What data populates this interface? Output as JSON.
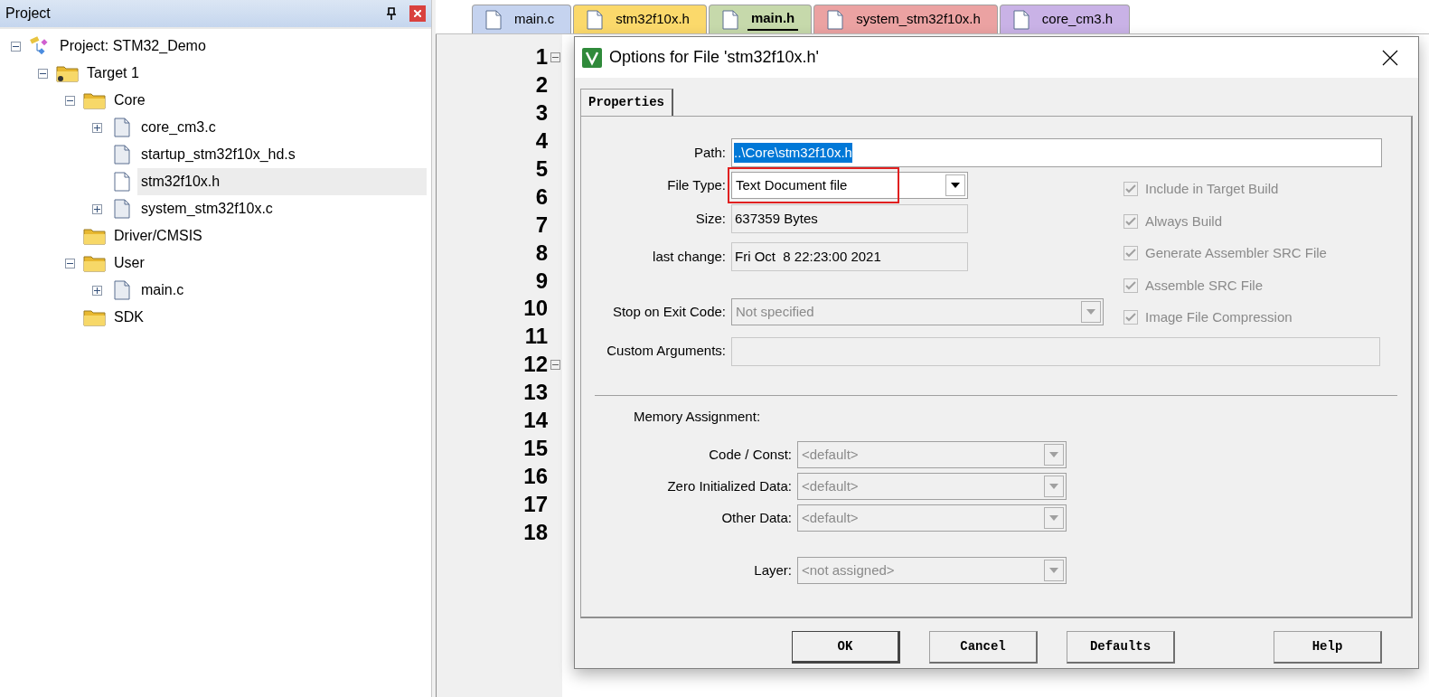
{
  "project_panel": {
    "title": "Project",
    "tree": [
      {
        "label": "Project: STM32_Demo",
        "kind": "project",
        "expanded": true,
        "selected": false,
        "children": [
          {
            "label": "Target 1",
            "kind": "target",
            "expanded": true,
            "selected": false,
            "children": [
              {
                "label": "Core",
                "kind": "folder",
                "expanded": true,
                "selected": false,
                "children": [
                  {
                    "label": "core_cm3.c",
                    "kind": "file",
                    "expanded": false,
                    "selected": false
                  },
                  {
                    "label": "startup_stm32f10x_hd.s",
                    "kind": "file",
                    "selected": false
                  },
                  {
                    "label": "stm32f10x.h",
                    "kind": "header",
                    "selected": true
                  },
                  {
                    "label": "system_stm32f10x.c",
                    "kind": "file",
                    "expanded": false,
                    "selected": false
                  }
                ]
              },
              {
                "label": "Driver/CMSIS",
                "kind": "folder",
                "selected": false
              },
              {
                "label": "User",
                "kind": "folder",
                "expanded": true,
                "selected": false,
                "children": [
                  {
                    "label": "main.c",
                    "kind": "file",
                    "expanded": false,
                    "selected": false
                  }
                ]
              },
              {
                "label": "SDK",
                "kind": "folder",
                "selected": false
              }
            ]
          }
        ]
      }
    ]
  },
  "editor": {
    "tabs": [
      {
        "label": "main.c",
        "color": "#c5d3ef",
        "selected": false
      },
      {
        "label": "stm32f10x.h",
        "color": "#fbd96b",
        "selected": false
      },
      {
        "label": "main.h",
        "color": "#c6d9ab",
        "selected": true
      },
      {
        "label": "system_stm32f10x.h",
        "color": "#eba2a2",
        "selected": false
      },
      {
        "label": "core_cm3.h",
        "color": "#c9b2e6",
        "selected": false
      }
    ],
    "lines": [
      {
        "number": "1",
        "foldable": true
      },
      {
        "number": "2",
        "foldable": false
      },
      {
        "number": "3",
        "foldable": false
      },
      {
        "number": "4",
        "foldable": false
      },
      {
        "number": "5",
        "foldable": false
      },
      {
        "number": "6",
        "foldable": false
      },
      {
        "number": "7",
        "foldable": false
      },
      {
        "number": "8",
        "foldable": false
      },
      {
        "number": "9",
        "foldable": false
      },
      {
        "number": "10",
        "foldable": false
      },
      {
        "number": "11",
        "foldable": false
      },
      {
        "number": "12",
        "foldable": true
      },
      {
        "number": "13",
        "foldable": false
      },
      {
        "number": "14",
        "foldable": false
      },
      {
        "number": "15",
        "foldable": false
      },
      {
        "number": "16",
        "foldable": false
      },
      {
        "number": "17",
        "foldable": false
      },
      {
        "number": "18",
        "foldable": false
      }
    ]
  },
  "dialog": {
    "title": "Options for File 'stm32f10x.h'",
    "tabs": [
      {
        "label": "Properties",
        "selected": true
      }
    ],
    "path": {
      "label": "Path:",
      "value": "..\\Core\\stm32f10x.h"
    },
    "file_type": {
      "label": "File Type:",
      "value": "Text Document file",
      "highlighted": true
    },
    "size": {
      "label": "Size:",
      "value": "637359 Bytes"
    },
    "last_change": {
      "label": "last change:",
      "value": "Fri Oct  8 22:23:00 2021"
    },
    "stop_on_exit": {
      "label": "Stop on Exit Code:",
      "value": "Not specified",
      "disabled": true
    },
    "custom_arguments": {
      "label": "Custom Arguments:"
    },
    "options": [
      {
        "label": "Include in Target Build",
        "checked": true,
        "disabled": true
      },
      {
        "label": "Always Build",
        "checked": true,
        "disabled": true
      },
      {
        "label": "Generate Assembler SRC File",
        "checked": true,
        "disabled": true
      },
      {
        "label": "Assemble SRC File",
        "checked": true,
        "disabled": true
      },
      {
        "label": "Image File Compression",
        "checked": true,
        "disabled": true
      }
    ],
    "memory_assignment": {
      "heading": "Memory Assignment:",
      "fields": [
        {
          "label": "Code / Const:",
          "value": "<default>",
          "disabled": true
        },
        {
          "label": "Zero Initialized Data:",
          "value": "<default>",
          "disabled": true
        },
        {
          "label": "Other Data:",
          "value": "<default>",
          "disabled": true
        }
      ],
      "layer": {
        "label": "Layer:",
        "value": "<not assigned>",
        "disabled": true
      }
    },
    "buttons": [
      {
        "label": "OK",
        "default": true
      },
      {
        "label": "Cancel",
        "default": false
      },
      {
        "label": "Defaults",
        "default": false
      },
      {
        "label": "Help",
        "default": false
      }
    ]
  }
}
